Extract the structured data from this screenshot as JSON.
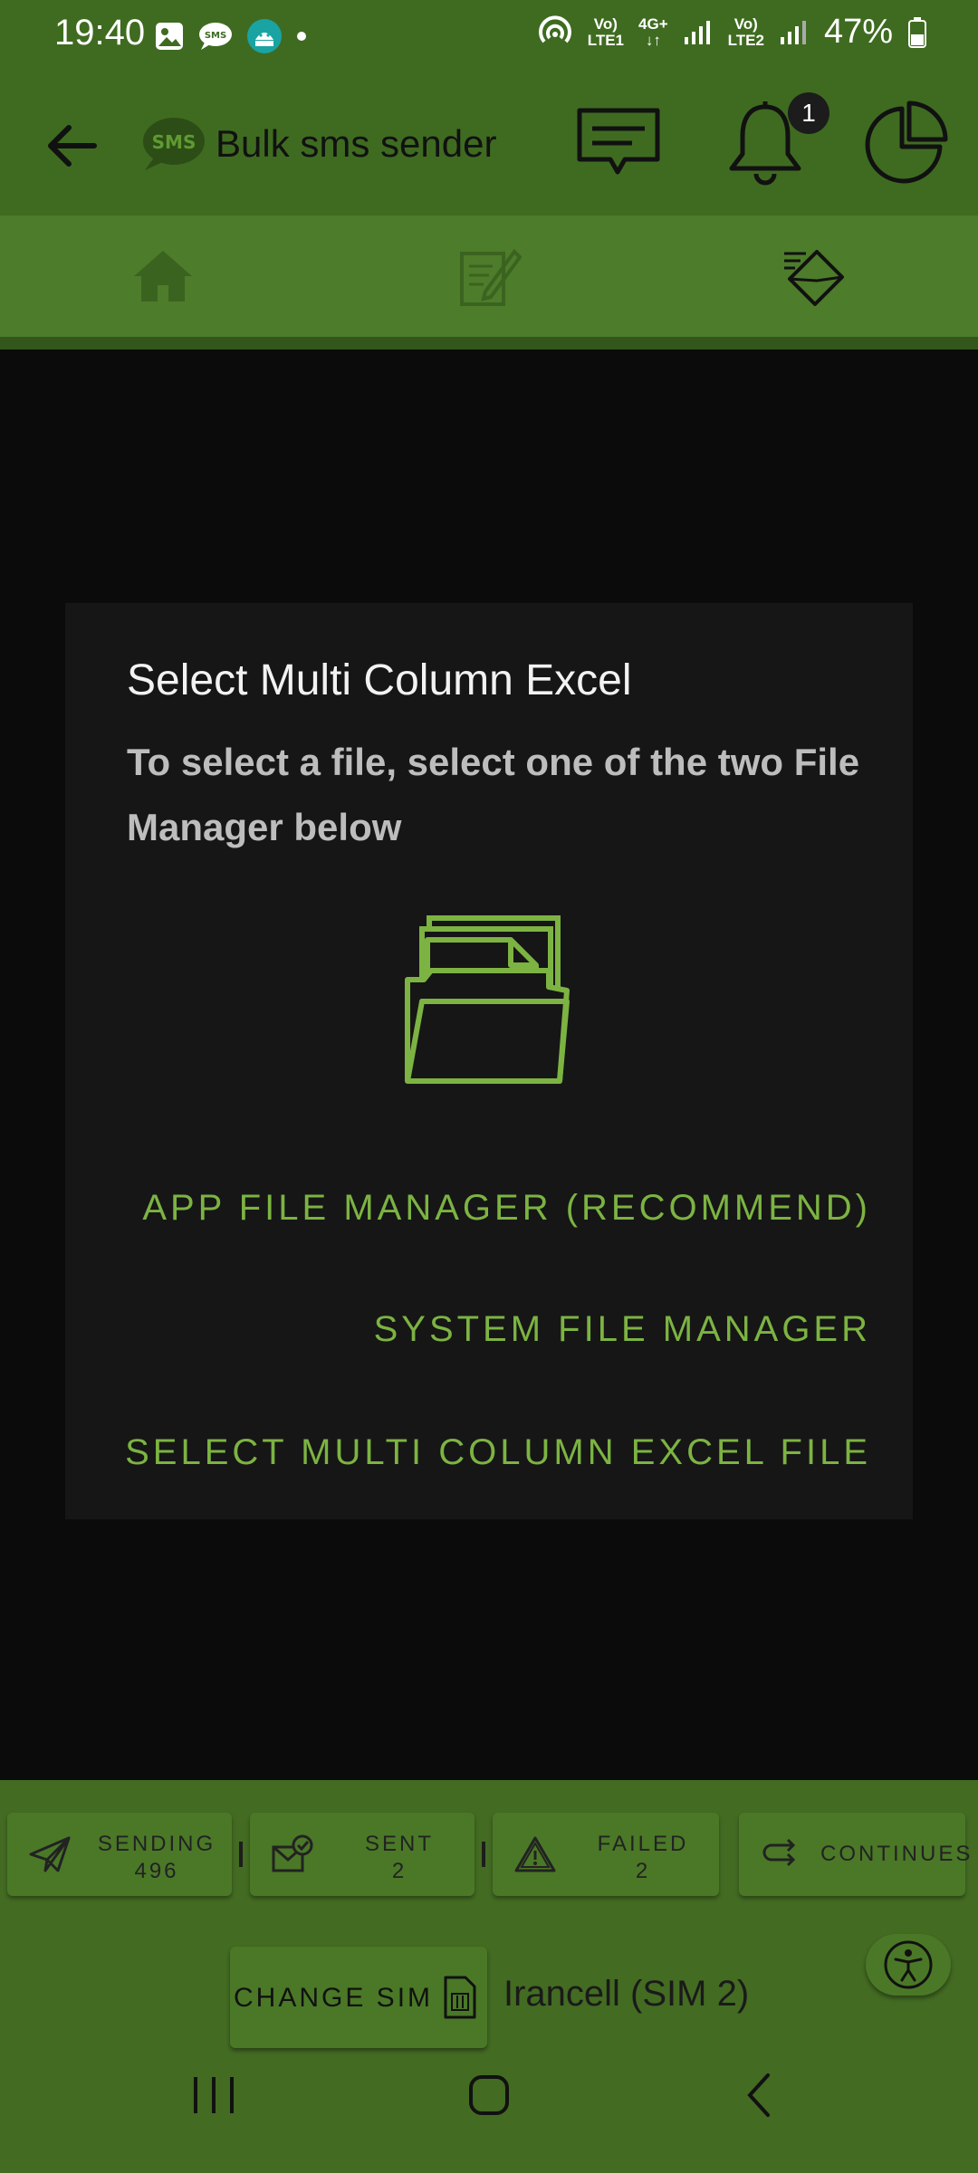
{
  "status_bar": {
    "time": "19:40",
    "battery": "47%",
    "net1_top": "Vo)",
    "net1_bottom": "LTE1",
    "net_4g": "4G+",
    "net2_top": "Vo)",
    "net2_bottom": "LTE2",
    "left_icons": [
      "gallery-icon",
      "sms-icon",
      "android-icon",
      "dot-icon"
    ]
  },
  "app_bar": {
    "logo_text": "SMS",
    "title": "Bulk sms sender",
    "notification_count": "1",
    "actions": [
      "message-icon",
      "bell-icon",
      "pie-chart-icon"
    ]
  },
  "tabs": [
    "home-icon",
    "edit-note-icon",
    "mail-send-icon"
  ],
  "dialog": {
    "title": "Select Multi Column Excel",
    "message": "To select a file, select one of the two File Manager below",
    "buttons": {
      "app_file_manager": "APP FILE MANAGER (RECOMMEND)",
      "system_file_manager": "SYSTEM FILE MANAGER",
      "select_excel": "SELECT MULTI COLUMN EXCEL FILE"
    }
  },
  "stats": {
    "sending": {
      "label": "SENDING",
      "value": "496"
    },
    "sent": {
      "label": "SENT",
      "value": "2"
    },
    "failed": {
      "label": "FAILED",
      "value": "2"
    },
    "continues": {
      "label": "CONTINUES"
    }
  },
  "sim": {
    "change_label": "CHANGE SIM",
    "current": "Irancell (SIM 2)"
  },
  "colors": {
    "app_bar": "#3f6b21",
    "accent_green": "#7cb342",
    "dialog_bg": "#161616",
    "bottom_panel": "#436b22"
  }
}
